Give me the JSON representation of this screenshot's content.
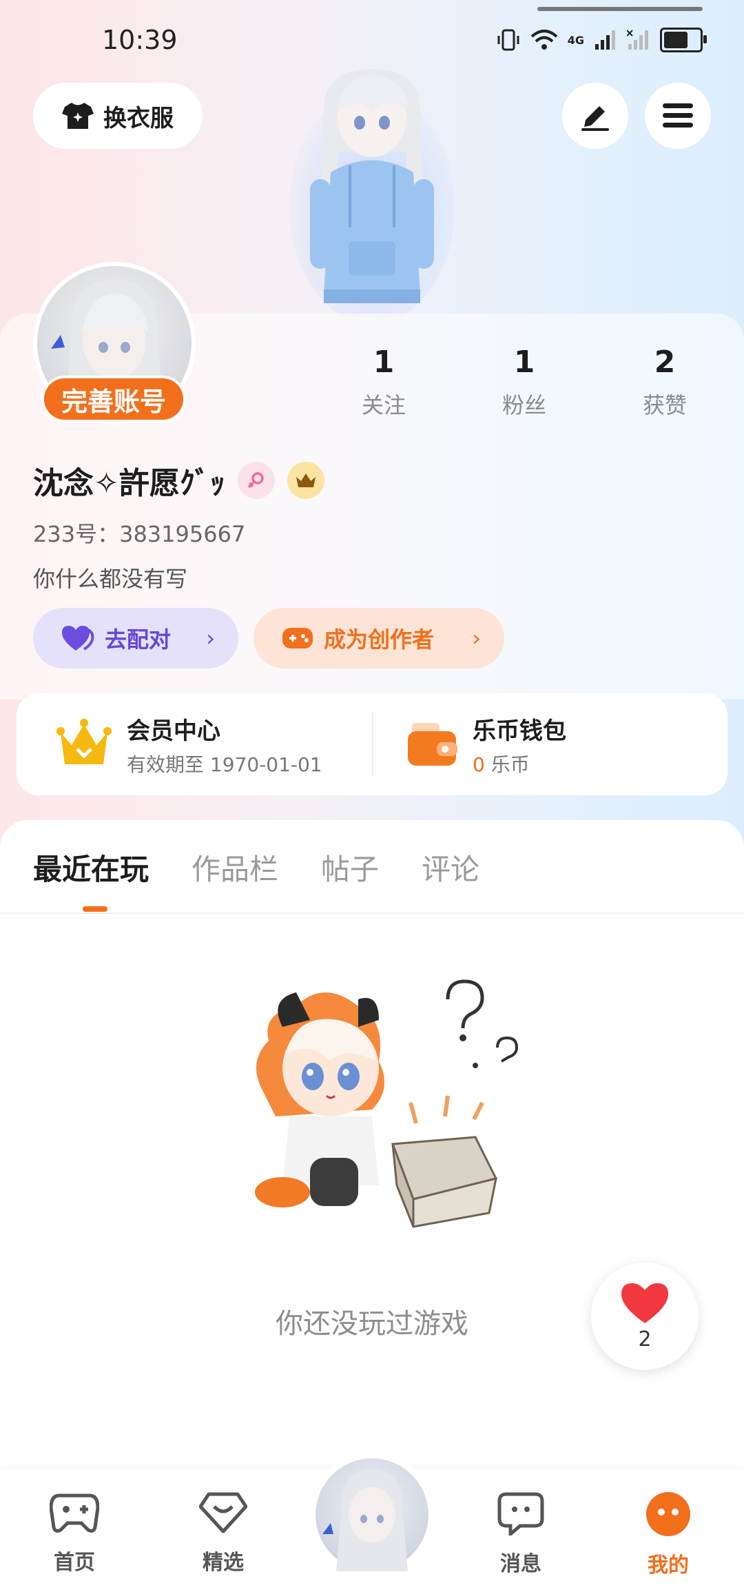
{
  "status_bar": {
    "time": "10:39",
    "network_label": "4G"
  },
  "header": {
    "outfit_button_label": "换衣服",
    "edit_icon": "pencil-icon",
    "menu_icon": "hamburger-icon"
  },
  "profile": {
    "complete_label": "完善账号",
    "stats": [
      {
        "value": "1",
        "label": "关注"
      },
      {
        "value": "1",
        "label": "粉丝"
      },
      {
        "value": "2",
        "label": "获赞"
      }
    ],
    "username": "沈念✧許愿ｸﾞｯ",
    "uid": "233号：383195667",
    "bio": "你什么都没有写",
    "pair_button_label": "去配对",
    "creator_button_label": "成为创作者"
  },
  "vip": {
    "member_title": "会员中心",
    "member_sub": "有效期至 1970-01-01",
    "wallet_title": "乐币钱包",
    "wallet_amount": "0",
    "wallet_unit": "乐币"
  },
  "tabs": [
    "最近在玩",
    "作品栏",
    "帖子",
    "评论"
  ],
  "empty_state": {
    "text": "你还没玩过游戏"
  },
  "like_fab": {
    "count": "2"
  },
  "bottom_nav": [
    {
      "label": "首页"
    },
    {
      "label": "精选"
    },
    {
      "label": "消息"
    },
    {
      "label": "我的"
    }
  ],
  "colors": {
    "accent_orange": "#f26f1c",
    "pair_purple": "#6547d8",
    "vip_gold": "#f5b90f",
    "heart_red": "#f0383e"
  }
}
